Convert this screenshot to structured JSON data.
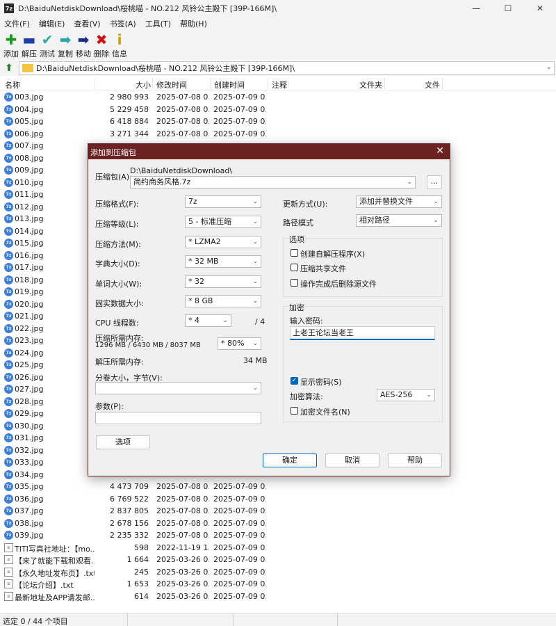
{
  "window": {
    "icon_text": "7z",
    "title": "D:\\BaiduNetdiskDownload\\桜桃喵 - NO.212 风铃公主殿下 [39P-166M]\\",
    "min": "—",
    "max": "☐",
    "close": "✕"
  },
  "menu": [
    "文件(F)",
    "编辑(E)",
    "查看(V)",
    "书签(A)",
    "工具(T)",
    "帮助(H)"
  ],
  "toolbar": [
    {
      "label": "添加",
      "icon": "plus-icon",
      "glyph": "✚",
      "color": "#1a9a1a"
    },
    {
      "label": "解压",
      "icon": "minus-icon",
      "glyph": "▬",
      "color": "#1a3fa8"
    },
    {
      "label": "测试",
      "icon": "check-icon",
      "glyph": "✔",
      "color": "#2aa8a8"
    },
    {
      "label": "复制",
      "icon": "copy-arrow-icon",
      "glyph": "➡",
      "color": "#2aa8a8"
    },
    {
      "label": "移动",
      "icon": "move-arrow-icon",
      "glyph": "➡",
      "color": "#1a2f8a"
    },
    {
      "label": "删除",
      "icon": "delete-x-icon",
      "glyph": "✖",
      "color": "#d01010"
    },
    {
      "label": "信息",
      "icon": "info-icon",
      "glyph": "i",
      "color": "#c8a000"
    }
  ],
  "address": {
    "path": "D:\\BaiduNetdiskDownload\\桜桃喵 - NO.212 风铃公主殿下 [39P-166M]\\",
    "dropdown": "⌄"
  },
  "columns": {
    "name": "名称",
    "size": "大小",
    "modified": "修改时间",
    "created": "创建时间",
    "comment": "注释",
    "folders": "文件夹",
    "files": "文件"
  },
  "files": [
    {
      "name": "003.jpg",
      "size": "2 980 993",
      "modified": "2025-07-08 0...",
      "created": "2025-07-09 0...",
      "type": "jpg"
    },
    {
      "name": "004.jpg",
      "size": "5 229 458",
      "modified": "2025-07-08 0...",
      "created": "2025-07-09 0...",
      "type": "jpg"
    },
    {
      "name": "005.jpg",
      "size": "6 418 884",
      "modified": "2025-07-08 0...",
      "created": "2025-07-09 0...",
      "type": "jpg"
    },
    {
      "name": "006.jpg",
      "size": "3 271 344",
      "modified": "2025-07-08 0...",
      "created": "2025-07-09 0...",
      "type": "jpg"
    },
    {
      "name": "007.jpg",
      "size": "",
      "modified": "",
      "created": "",
      "type": "jpg"
    },
    {
      "name": "008.jpg",
      "size": "",
      "modified": "",
      "created": "",
      "type": "jpg"
    },
    {
      "name": "009.jpg",
      "size": "",
      "modified": "",
      "created": "",
      "type": "jpg"
    },
    {
      "name": "010.jpg",
      "size": "",
      "modified": "",
      "created": "",
      "type": "jpg"
    },
    {
      "name": "011.jpg",
      "size": "",
      "modified": "",
      "created": "",
      "type": "jpg"
    },
    {
      "name": "012.jpg",
      "size": "",
      "modified": "",
      "created": "",
      "type": "jpg"
    },
    {
      "name": "013.jpg",
      "size": "",
      "modified": "",
      "created": "",
      "type": "jpg"
    },
    {
      "name": "014.jpg",
      "size": "",
      "modified": "",
      "created": "",
      "type": "jpg"
    },
    {
      "name": "015.jpg",
      "size": "",
      "modified": "",
      "created": "",
      "type": "jpg"
    },
    {
      "name": "016.jpg",
      "size": "",
      "modified": "",
      "created": "",
      "type": "jpg"
    },
    {
      "name": "017.jpg",
      "size": "",
      "modified": "",
      "created": "",
      "type": "jpg"
    },
    {
      "name": "018.jpg",
      "size": "",
      "modified": "",
      "created": "",
      "type": "jpg"
    },
    {
      "name": "019.jpg",
      "size": "",
      "modified": "",
      "created": "",
      "type": "jpg"
    },
    {
      "name": "020.jpg",
      "size": "",
      "modified": "",
      "created": "",
      "type": "jpg"
    },
    {
      "name": "021.jpg",
      "size": "",
      "modified": "",
      "created": "",
      "type": "jpg"
    },
    {
      "name": "022.jpg",
      "size": "",
      "modified": "",
      "created": "",
      "type": "jpg"
    },
    {
      "name": "023.jpg",
      "size": "",
      "modified": "",
      "created": "",
      "type": "jpg"
    },
    {
      "name": "024.jpg",
      "size": "",
      "modified": "",
      "created": "",
      "type": "jpg"
    },
    {
      "name": "025.jpg",
      "size": "",
      "modified": "",
      "created": "",
      "type": "jpg"
    },
    {
      "name": "026.jpg",
      "size": "",
      "modified": "",
      "created": "",
      "type": "jpg"
    },
    {
      "name": "027.jpg",
      "size": "",
      "modified": "",
      "created": "",
      "type": "jpg"
    },
    {
      "name": "028.jpg",
      "size": "",
      "modified": "",
      "created": "",
      "type": "jpg"
    },
    {
      "name": "029.jpg",
      "size": "",
      "modified": "",
      "created": "",
      "type": "jpg"
    },
    {
      "name": "030.jpg",
      "size": "",
      "modified": "",
      "created": "",
      "type": "jpg"
    },
    {
      "name": "031.jpg",
      "size": "",
      "modified": "",
      "created": "",
      "type": "jpg"
    },
    {
      "name": "032.jpg",
      "size": "",
      "modified": "",
      "created": "",
      "type": "jpg"
    },
    {
      "name": "033.jpg",
      "size": "",
      "modified": "",
      "created": "",
      "type": "jpg"
    },
    {
      "name": "034.jpg",
      "size": "",
      "modified": "",
      "created": "",
      "type": "jpg"
    },
    {
      "name": "035.jpg",
      "size": "4 473 709",
      "modified": "2025-07-08 0...",
      "created": "2025-07-09 0...",
      "type": "jpg"
    },
    {
      "name": "036.jpg",
      "size": "6 769 522",
      "modified": "2025-07-08 0...",
      "created": "2025-07-09 0...",
      "type": "jpg"
    },
    {
      "name": "037.jpg",
      "size": "2 837 805",
      "modified": "2025-07-08 0...",
      "created": "2025-07-09 0...",
      "type": "jpg"
    },
    {
      "name": "038.jpg",
      "size": "2 678 156",
      "modified": "2025-07-08 0...",
      "created": "2025-07-09 0...",
      "type": "jpg"
    },
    {
      "name": "039.jpg",
      "size": "2 235 332",
      "modified": "2025-07-08 0...",
      "created": "2025-07-09 0...",
      "type": "jpg"
    },
    {
      "name": "TITI写真社地址：【mo...",
      "size": "598",
      "modified": "2022-11-19 1...",
      "created": "2025-07-09 0...",
      "type": "txt"
    },
    {
      "name": "【来了就能下载和观看...",
      "size": "1 664",
      "modified": "2025-03-26 0...",
      "created": "2025-07-09 0...",
      "type": "txt"
    },
    {
      "name": "【永久地址发布页】.txt",
      "size": "245",
      "modified": "2025-03-26 0...",
      "created": "2025-07-09 0...",
      "type": "txt"
    },
    {
      "name": "【论坛介绍】.txt",
      "size": "1 653",
      "modified": "2025-03-26 0...",
      "created": "2025-07-09 0...",
      "type": "txt"
    },
    {
      "name": "最新地址及APP请发邮...",
      "size": "614",
      "modified": "2025-03-26 0...",
      "created": "2025-07-09 0...",
      "type": "txt"
    }
  ],
  "status": {
    "text": "选定 0 / 44 个项目"
  },
  "dialog": {
    "title": "添加到压缩包",
    "close": "✕",
    "archive_label": "压缩包(A)",
    "archive_dir": "D:\\BaiduNetdiskDownload\\",
    "archive_name": "简约商务风格.7z",
    "browse": "...",
    "format_label": "压缩格式(F):",
    "format_value": "7z",
    "level_label": "压缩等级(L):",
    "level_value": "5 - 标准压缩",
    "method_label": "压缩方法(M):",
    "method_value": "* LZMA2",
    "dict_label": "字典大小(D):",
    "dict_value": "* 32 MB",
    "word_label": "单词大小(W):",
    "word_value": "* 32",
    "solid_label": "固实数据大小:",
    "solid_value": "* 8 GB",
    "cpu_label": "CPU 线程数:",
    "cpu_value": "* 4",
    "cpu_total": "/ 4",
    "mem_label": "压缩所需内存:",
    "mem_detail": "1296 MB / 6430 MB / 8037 MB",
    "mem_value": "* 80%",
    "decomp_label": "解压所需内存:",
    "decomp_value": "34 MB",
    "split_label": "分卷大小，字节(V):",
    "split_value": "",
    "params_label": "参数(P):",
    "params_value": "",
    "options_button": "选项",
    "update_label": "更新方式(U):",
    "update_value": "添加并替换文件",
    "path_label": "路径模式",
    "path_value": "相对路径",
    "options_group": "选项",
    "opt_sfx": "创建自解压程序(X)",
    "opt_shared": "压缩共享文件",
    "opt_delete": "操作完成后删除源文件",
    "encrypt_group": "加密",
    "password_label": "输入密码:",
    "password_value": "上老王论坛当老王",
    "show_password": "显示密码(S)",
    "enc_method_label": "加密算法:",
    "enc_method_value": "AES-256",
    "encrypt_names": "加密文件名(N)",
    "ok": "确定",
    "cancel": "取消",
    "help": "帮助",
    "dd": "⌄"
  }
}
